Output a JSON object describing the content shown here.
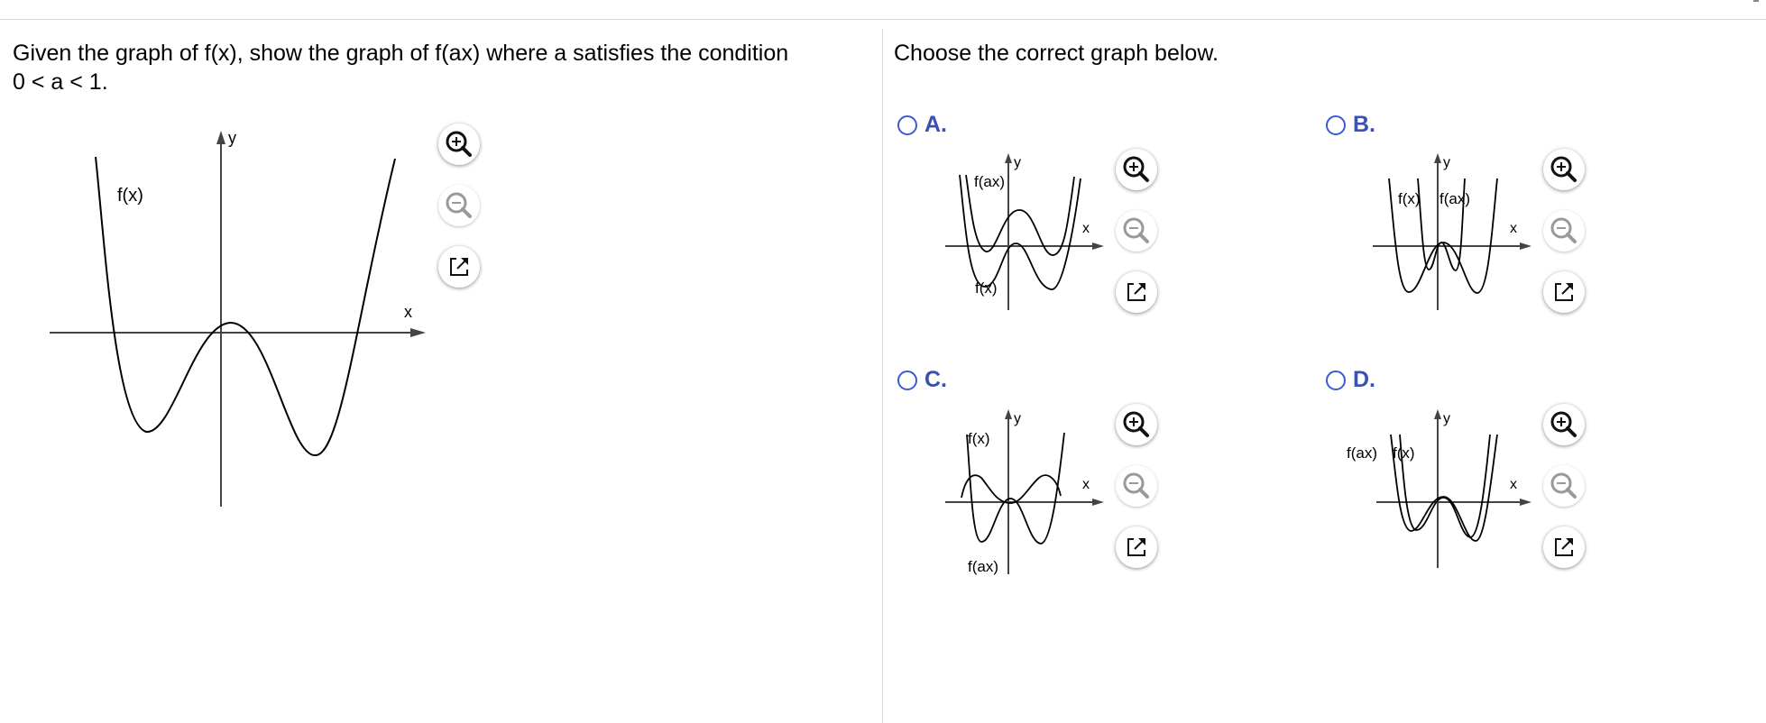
{
  "question": {
    "line1": "Given the graph of f(x), show the graph of f(ax) where a satisfies the condition",
    "line2": "0 < a < 1."
  },
  "prompt": "Choose the correct graph below.",
  "main_graph": {
    "axis_x": "x",
    "axis_y": "y",
    "curve_label": "f(x)"
  },
  "options": [
    {
      "letter": "A.",
      "labels": [
        "f(ax)",
        "f(x)"
      ]
    },
    {
      "letter": "B.",
      "labels": [
        "f(x)",
        "f(ax)"
      ]
    },
    {
      "letter": "C.",
      "labels": [
        "f(x)",
        "f(ax)"
      ]
    },
    {
      "letter": "D.",
      "labels": [
        "f(ax)",
        "f(x)"
      ]
    }
  ],
  "axis_labels": {
    "x": "x",
    "y": "y"
  },
  "icons": {
    "zoom_in": "zoom-in-icon",
    "zoom_out": "zoom-out-icon",
    "open_external": "open-new-window-icon"
  },
  "colors": {
    "accent": "#3e59d6",
    "option_letter": "#3a50b4",
    "divider": "#d9d9d9",
    "axis": "#444444",
    "curve": "#000000"
  }
}
